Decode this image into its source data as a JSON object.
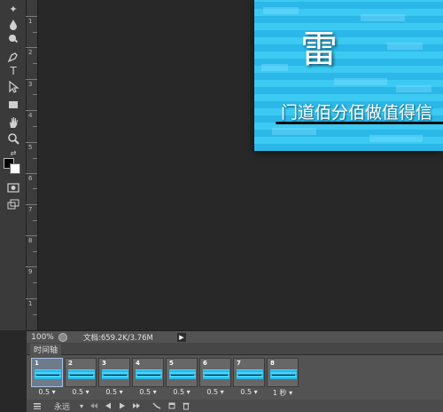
{
  "toolbar": {
    "tools": [
      {
        "icon": "dodge-icon",
        "glyph": "✦"
      },
      {
        "icon": "blur-drop-icon",
        "glyph": "💧"
      },
      {
        "icon": "sponge-icon",
        "glyph": "●"
      },
      {
        "icon": "pen-icon",
        "glyph": "✒"
      },
      {
        "icon": "type-icon",
        "glyph": "T"
      },
      {
        "icon": "path-selection-icon",
        "glyph": "↖"
      },
      {
        "icon": "rectangle-icon",
        "glyph": "▭"
      },
      {
        "icon": "hand-icon",
        "glyph": "✋"
      },
      {
        "icon": "zoom-icon",
        "glyph": "🔍"
      },
      {
        "icon": "quick-mask-icon",
        "glyph": "◎"
      },
      {
        "icon": "screen-mode-icon",
        "glyph": "⧉"
      }
    ],
    "foreground_color": "#000000",
    "background_color": "#ffffff"
  },
  "ruler": {
    "labels": [
      "1",
      "2",
      "3",
      "4",
      "5",
      "6",
      "7",
      "8",
      "9",
      "1"
    ]
  },
  "document": {
    "title": "雷",
    "subtitle": "门道佰分佰做值得信",
    "colors": {
      "primary": "#2bb7e8",
      "secondary": "#3ccaf3"
    }
  },
  "status": {
    "zoom": "100%",
    "doc_size": "文档:659.2K/3.76M",
    "arrow": "▶"
  },
  "timeline": {
    "tab_label": "时间轴",
    "frames": [
      {
        "number": "1",
        "delay": "0.5 ▾",
        "selected": true
      },
      {
        "number": "2",
        "delay": "0.5 ▾",
        "selected": false
      },
      {
        "number": "3",
        "delay": "0.5 ▾",
        "selected": false
      },
      {
        "number": "4",
        "delay": "0.5 ▾",
        "selected": false
      },
      {
        "number": "5",
        "delay": "0.5 ▾",
        "selected": false
      },
      {
        "number": "6",
        "delay": "0.5 ▾",
        "selected": false
      },
      {
        "number": "7",
        "delay": "0.5 ▾",
        "selected": false
      },
      {
        "number": "8",
        "delay": "1 秒 ▾",
        "selected": false
      }
    ],
    "loop_option": "永远",
    "loop_arrow": "▾"
  }
}
